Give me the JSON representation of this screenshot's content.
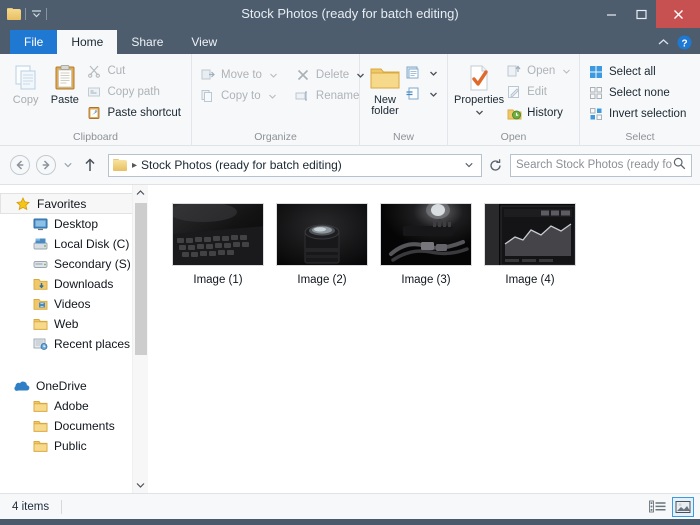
{
  "window": {
    "title": "Stock Photos (ready for batch editing)",
    "quick_access": {
      "folder_icon": "folder-icon",
      "dropdown_icon": "chevron-down-icon"
    },
    "controls": {
      "minimize": "minimize-icon",
      "maximize": "maximize-icon",
      "close": "close-icon",
      "close_color": "#c75050"
    }
  },
  "tabs": [
    {
      "label": "File",
      "state": "file"
    },
    {
      "label": "Home",
      "state": "active"
    },
    {
      "label": "Share",
      "state": "inactive"
    },
    {
      "label": "View",
      "state": "inactive"
    }
  ],
  "ribbon": {
    "collapse_icon": "chevron-up-icon",
    "help_icon": "help-icon",
    "groups": [
      {
        "label": "Clipboard",
        "big_buttons": [
          {
            "label": "Copy",
            "icon": "copy-icon",
            "enabled": false
          },
          {
            "label": "Paste",
            "icon": "paste-icon",
            "enabled": true
          }
        ],
        "small_buttons": [
          {
            "label": "Cut",
            "icon": "cut-icon",
            "enabled": false
          },
          {
            "label": "Copy path",
            "icon": "copy-path-icon",
            "enabled": false
          },
          {
            "label": "Paste shortcut",
            "icon": "paste-shortcut-icon",
            "enabled": true
          }
        ]
      },
      {
        "label": "Organize",
        "small_buttons": [
          {
            "label": "Move to",
            "icon": "move-to-icon",
            "enabled": false,
            "caret": true
          },
          {
            "label": "Copy to",
            "icon": "copy-to-icon",
            "enabled": false,
            "caret": true
          },
          {
            "label": "Delete",
            "icon": "delete-icon",
            "enabled": false,
            "caret": true
          },
          {
            "label": "Rename",
            "icon": "rename-icon",
            "enabled": false,
            "caret": false
          }
        ]
      },
      {
        "label": "New",
        "big_buttons": [
          {
            "label": "New folder",
            "icon": "new-folder-icon",
            "enabled": true
          }
        ],
        "small_buttons": [
          {
            "label": "",
            "icon": "new-item-icon",
            "enabled": true,
            "caret": true
          },
          {
            "label": "",
            "icon": "easy-access-icon",
            "enabled": true,
            "caret": true
          }
        ]
      },
      {
        "label": "Open",
        "big_buttons": [
          {
            "label": "Properties",
            "icon": "properties-icon",
            "enabled": true,
            "caret": true
          }
        ],
        "small_buttons": [
          {
            "label": "Open",
            "icon": "open-icon",
            "enabled": false,
            "caret": true
          },
          {
            "label": "Edit",
            "icon": "edit-icon",
            "enabled": false,
            "caret": false
          },
          {
            "label": "History",
            "icon": "history-icon",
            "enabled": true,
            "caret": false
          }
        ]
      },
      {
        "label": "Select",
        "small_buttons": [
          {
            "label": "Select all",
            "icon": "select-all-icon",
            "enabled": true
          },
          {
            "label": "Select none",
            "icon": "select-none-icon",
            "enabled": true
          },
          {
            "label": "Invert selection",
            "icon": "invert-selection-icon",
            "enabled": true
          }
        ]
      }
    ]
  },
  "addressbar": {
    "back_icon": "back-arrow-icon",
    "forward_icon": "forward-arrow-icon",
    "recent_icon": "chevron-down-icon",
    "up_icon": "up-arrow-icon",
    "folder_icon": "folder-icon",
    "separator": "▸",
    "path": "Stock Photos (ready for batch editing)",
    "dropdown_icon": "chevron-down-icon",
    "refresh_icon": "refresh-icon",
    "search_placeholder": "Search Stock Photos (ready fo...",
    "search_value": "",
    "search_icon": "search-icon"
  },
  "navpane": {
    "scroll_up_icon": "chevron-up-icon",
    "scroll_down_icon": "chevron-down-icon",
    "sections": [
      {
        "header": {
          "label": "Favorites",
          "icon": "star-icon",
          "selected": true
        },
        "items": [
          {
            "label": "Desktop",
            "icon": "desktop-icon"
          },
          {
            "label": "Local Disk (C)",
            "icon": "drive-icon"
          },
          {
            "label": "Secondary (S)",
            "icon": "drive-icon"
          },
          {
            "label": "Downloads",
            "icon": "downloads-folder-icon"
          },
          {
            "label": "Videos",
            "icon": "videos-folder-icon"
          },
          {
            "label": "Web",
            "icon": "folder-icon"
          },
          {
            "label": "Recent places",
            "icon": "recent-places-icon"
          }
        ]
      },
      {
        "header": {
          "label": "OneDrive",
          "icon": "onedrive-icon",
          "selected": false
        },
        "items": [
          {
            "label": "Adobe",
            "icon": "folder-icon"
          },
          {
            "label": "Documents",
            "icon": "folder-icon"
          },
          {
            "label": "Public",
            "icon": "folder-icon"
          }
        ]
      }
    ]
  },
  "files": [
    {
      "name": "Image (1)",
      "thumb": "keyboard-photo"
    },
    {
      "name": "Image (2)",
      "thumb": "camera-lens-photo"
    },
    {
      "name": "Image (3)",
      "thumb": "cables-photo"
    },
    {
      "name": "Image (4)",
      "thumb": "monitor-chart-photo"
    }
  ],
  "statusbar": {
    "item_count": "4 items",
    "view_buttons": [
      {
        "name": "details-view",
        "active": false
      },
      {
        "name": "thumbnail-view",
        "active": true
      }
    ],
    "accent": "#3d9ae0"
  }
}
